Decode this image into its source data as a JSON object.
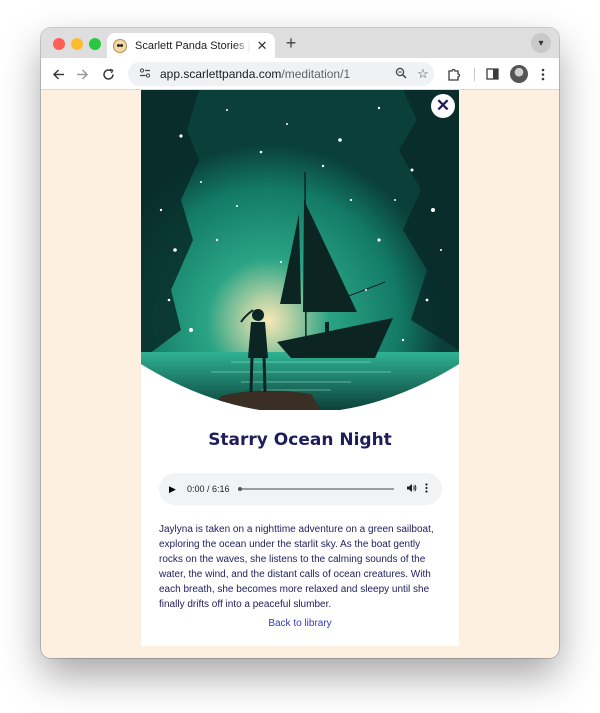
{
  "browser": {
    "tab_title": "Scarlett Panda Stories | AI Generated",
    "tab_close": "✕",
    "new_tab": "+",
    "url_host": "app.scarlettpanda.com",
    "url_path": "/meditation/1"
  },
  "story": {
    "title": "Starry Ocean Night",
    "close_label": "✕",
    "audio_time": "0:00 / 6:16",
    "audio_progress": 0,
    "description": "Jaylyna is taken on a nighttime adventure on a green sailboat, exploring the ocean under the starlit sky. As the boat gently rocks on the waves, she listens to the calming sounds of the water, the wind, and the distant calls of ocean creatures. With each breath, she becomes more relaxed and sleepy until she finally drifts off into a peaceful slumber.",
    "back_link": "Back to library"
  },
  "colors": {
    "page_bg": "#fdf0e1",
    "title": "#1f1d5c",
    "link": "#3a36c9",
    "sea": "#1f9a7e"
  },
  "icons": [
    "back-arrow-icon",
    "forward-arrow-icon",
    "reload-icon",
    "site-info-icon",
    "zoom-icon",
    "star-icon",
    "extensions-icon",
    "side-panel-icon",
    "profile-icon",
    "menu-icon",
    "close-icon",
    "play-icon",
    "volume-icon",
    "more-options-icon"
  ]
}
